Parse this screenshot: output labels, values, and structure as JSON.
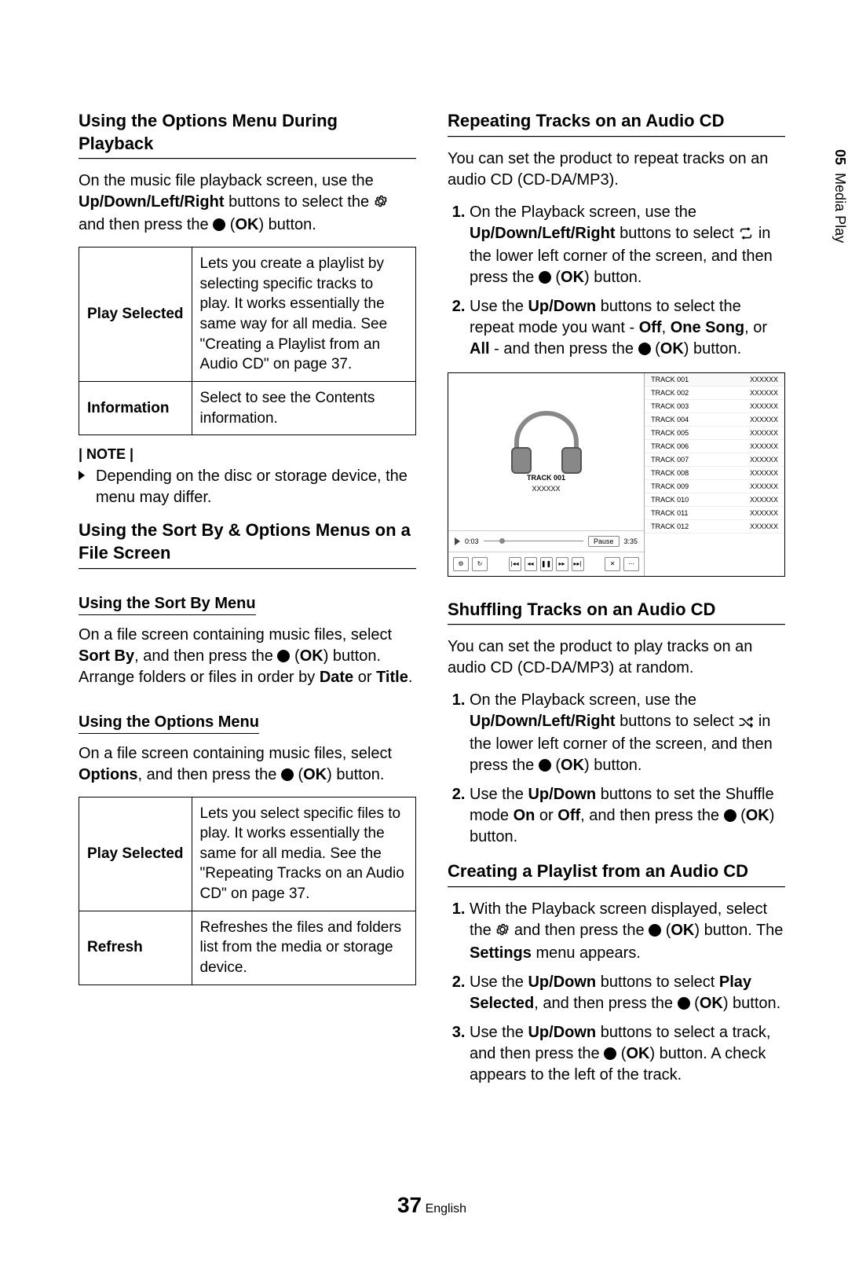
{
  "side_tab": {
    "num": "05",
    "label": "Media Play"
  },
  "left": {
    "h_options_playback": "Using the Options Menu During Playback",
    "playback_para_pre": "On the music file playback screen, use the ",
    "playback_para_btns": "Up/Down/Left/Right",
    "playback_para_mid": " buttons to select the ",
    "playback_para_post": " and then press the ",
    "ok_label": "OK",
    "playback_para_end": ") button.",
    "table1": {
      "r1_key": "Play Selected",
      "r1_val": "Lets you create a playlist by selecting specific tracks to play. It works essentially the same way for all media. See \"Creating a Playlist from an Audio CD\" on page 37.",
      "r2_key": "Information",
      "r2_val": "Select to see the Contents information."
    },
    "note_label": "| NOTE |",
    "note_item": "Depending on the disc or storage device, the menu may differ.",
    "h_sortby": "Using the Sort By & Options Menus on a File Screen",
    "sub_sortby": "Using the Sort By Menu",
    "sortby_para_parts": {
      "a": "On a file screen containing music files, select ",
      "b": "Sort By",
      "c": ", and then press the ",
      "d": "OK",
      "e": ") button. Arrange folders or files in order by ",
      "f": "Date",
      "g": " or ",
      "h": "Title",
      "i": "."
    },
    "sub_options": "Using the Options Menu",
    "options_para_parts": {
      "a": "On a file screen containing music files, select ",
      "b": "Options",
      "c": ", and then press the ",
      "d": "OK",
      "e": ") button."
    },
    "table2": {
      "r1_key": "Play Selected",
      "r1_val": "Lets you select specific files to play. It works essentially the same for all media. See the \"Repeating Tracks on an Audio CD\" on page 37.",
      "r2_key": "Refresh",
      "r2_val": "Refreshes the files and folders list from the media or storage device."
    }
  },
  "right": {
    "h_repeat": "Repeating Tracks on an Audio CD",
    "repeat_intro": "You can set the product to repeat tracks on an audio CD (CD-DA/MP3).",
    "repeat_steps": {
      "s1_a": "On the Playback screen, use the ",
      "s1_b": "Up/Down/Left/Right",
      "s1_c": " buttons to select ",
      "s1_d": " in the lower left corner of the screen, and then press the ",
      "s1_e": "OK",
      "s1_f": ") button.",
      "s2_a": "Use the ",
      "s2_b": "Up/Down",
      "s2_c": " buttons to select the repeat mode you want - ",
      "s2_d": "Off",
      "s2_e": ", ",
      "s2_f": "One Song",
      "s2_g": ", or ",
      "s2_h": "All",
      "s2_i": " - and then press the ",
      "s2_j": "OK",
      "s2_k": ") button."
    },
    "player": {
      "now_track": "TRACK 001",
      "now_artist": "XXXXXX",
      "time_l": "0:03",
      "pause": "Pause",
      "time_r": "3:35",
      "tracks": [
        {
          "t": "TRACK 001",
          "a": "XXXXXX"
        },
        {
          "t": "TRACK 002",
          "a": "XXXXXX"
        },
        {
          "t": "TRACK 003",
          "a": "XXXXXX"
        },
        {
          "t": "TRACK 004",
          "a": "XXXXXX"
        },
        {
          "t": "TRACK 005",
          "a": "XXXXXX"
        },
        {
          "t": "TRACK 006",
          "a": "XXXXXX"
        },
        {
          "t": "TRACK 007",
          "a": "XXXXXX"
        },
        {
          "t": "TRACK 008",
          "a": "XXXXXX"
        },
        {
          "t": "TRACK 009",
          "a": "XXXXXX"
        },
        {
          "t": "TRACK 010",
          "a": "XXXXXX"
        },
        {
          "t": "TRACK 011",
          "a": "XXXXXX"
        },
        {
          "t": "TRACK 012",
          "a": "XXXXXX"
        }
      ]
    },
    "h_shuffle": "Shuffling Tracks on an Audio CD",
    "shuffle_intro": "You can set the product to play tracks on an audio CD (CD-DA/MP3) at random.",
    "shuffle_steps": {
      "s1_a": "On the Playback screen, use the ",
      "s1_b": "Up/Down/Left/Right",
      "s1_c": " buttons to select ",
      "s1_d": " in the lower left corner of the screen, and then press the ",
      "s1_e": "OK",
      "s1_f": ") button.",
      "s2_a": "Use the ",
      "s2_b": "Up/Down",
      "s2_c": " buttons to set the Shuffle mode ",
      "s2_d": "On",
      "s2_e": " or ",
      "s2_f": "Off",
      "s2_g": ", and then press the ",
      "s2_h": "OK",
      "s2_i": ") button."
    },
    "h_playlist": "Creating a Playlist from an Audio CD",
    "playlist_steps": {
      "s1_a": "With the Playback screen displayed, select the ",
      "s1_b": " and then press the ",
      "s1_c": "OK",
      "s1_d": ") button. The ",
      "s1_e": "Settings",
      "s1_f": " menu appears.",
      "s2_a": "Use the ",
      "s2_b": "Up/Down",
      "s2_c": " buttons to select ",
      "s2_d": "Play Selected",
      "s2_e": ", and then press the ",
      "s2_f": "OK",
      "s2_g": ") button.",
      "s3_a": "Use the ",
      "s3_b": "Up/Down",
      "s3_c": " buttons to select a track, and then press the ",
      "s3_d": "OK",
      "s3_e": ") button. A check appears to the left of the track."
    }
  },
  "footer": {
    "num": "37",
    "lang": "English"
  }
}
